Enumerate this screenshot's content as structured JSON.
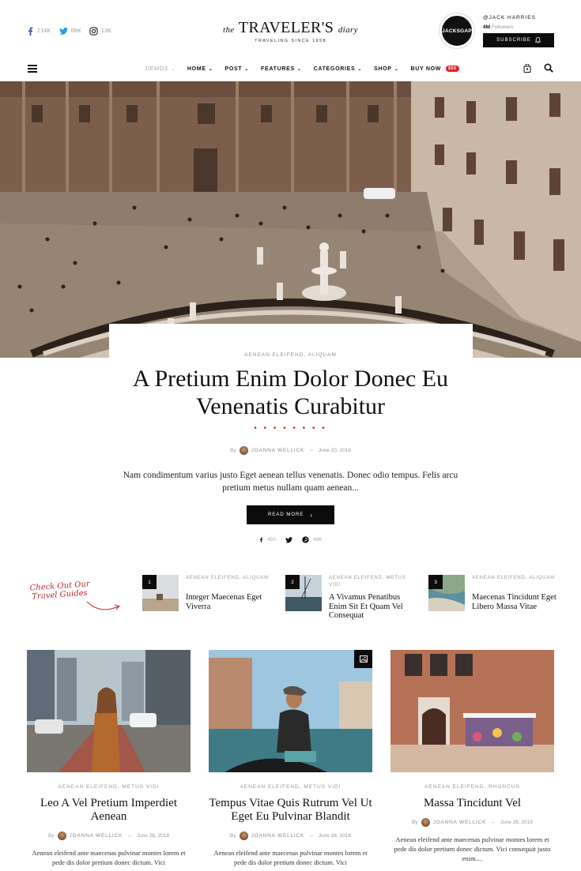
{
  "header": {
    "social": [
      {
        "icon": "facebook-icon",
        "count": "214K"
      },
      {
        "icon": "twitter-icon",
        "count": "66K"
      },
      {
        "icon": "instagram-icon",
        "count": "13K"
      }
    ],
    "logo": {
      "the": "the",
      "name": "TRAVELER'S",
      "diary": "diary",
      "tagline": "TRAVELING SINCE 1998"
    },
    "author": {
      "badge": "JACKSGAP",
      "handle": "@JACK HARRIES",
      "followers_count": "4M",
      "followers_label": "Followers"
    },
    "subscribe_label": "SUBSCRIBE"
  },
  "nav": {
    "items": [
      {
        "label": "DEMOS",
        "muted": true
      },
      {
        "label": "HOME"
      },
      {
        "label": "POST"
      },
      {
        "label": "FEATURES"
      },
      {
        "label": "CATEGORIES"
      },
      {
        "label": "SHOP"
      },
      {
        "label": "BUY NOW",
        "badge": "$59"
      }
    ],
    "accent_color": "#e0242b"
  },
  "hero": {
    "categories": "AENEAN ELEIFEND,  ALIQUAM",
    "title": "A Pretium Enim Dolor Donec Eu Venenatis Curabitur",
    "dots": "• • • • • • • •",
    "by": "By",
    "author": "JOANNA WELLICK",
    "separator": "–",
    "date": "June 20, 2018",
    "excerpt": "Nam condimentum varius justo Eget aenean tellus venenatis. Donec odio tempus. Felis arcu pretium metus nullam quam aenean...",
    "read_more": "READ MORE",
    "shares": {
      "facebook": "450",
      "pinterest": "486"
    }
  },
  "guides": {
    "label_line1": "Check Out Our",
    "label_line2": "Travel Guides",
    "items": [
      {
        "num": "1",
        "cats": "AENEAN ELEIFEND, ALIQUAM",
        "title": "Integer Maecenas Eget Viverra"
      },
      {
        "num": "2",
        "cats": "AENEAN ELEIFEND, METUS VIDI",
        "title": "A Vivamus Penatibus Enim Sit Et Quam Vel Consequat"
      },
      {
        "num": "3",
        "cats": "AENEAN ELEIFEND, ALIQUAM",
        "title": "Maecenas Tincidunt Eget Libero Massa Vitae"
      }
    ]
  },
  "cards": [
    {
      "cats": "AENEAN ELEIFEND,  METUS VIDI",
      "title": "Leo A Vel Pretium Imperdiet Aenean",
      "by": "By",
      "author": "JOANNA WELLICK",
      "sep": "–",
      "date": "June 28, 2018",
      "excerpt": "Aenean eleifend ante maecenas pulvinar montes lorem et pede dis dolor pretium donec dictum. Vici"
    },
    {
      "cats": "AENEAN ELEIFEND,  METUS VIDI",
      "title": "Tempus Vitae Quis Rutrum Vel Ut Eget Eu Pulvinar Blandit",
      "by": "By",
      "author": "JOANNA WELLICK",
      "sep": "–",
      "date": "June 28, 2018",
      "excerpt": "Aenean eleifend ante maecenas pulvinar montes lorem et pede dis dolor pretium donec dictum. Vici"
    },
    {
      "cats": "AENEAN ELEIFEND,  RHONCUS",
      "title": "Massa Tincidunt Vel",
      "by": "By",
      "author": "JOANNA WELLICK",
      "sep": "–",
      "date": "June 28, 2018",
      "excerpt": "Aenean eleifend ante maecenas pulvinar montes lorem et pede dis dolor pretium donec dictum. Vici consequat justo enim...."
    }
  ]
}
